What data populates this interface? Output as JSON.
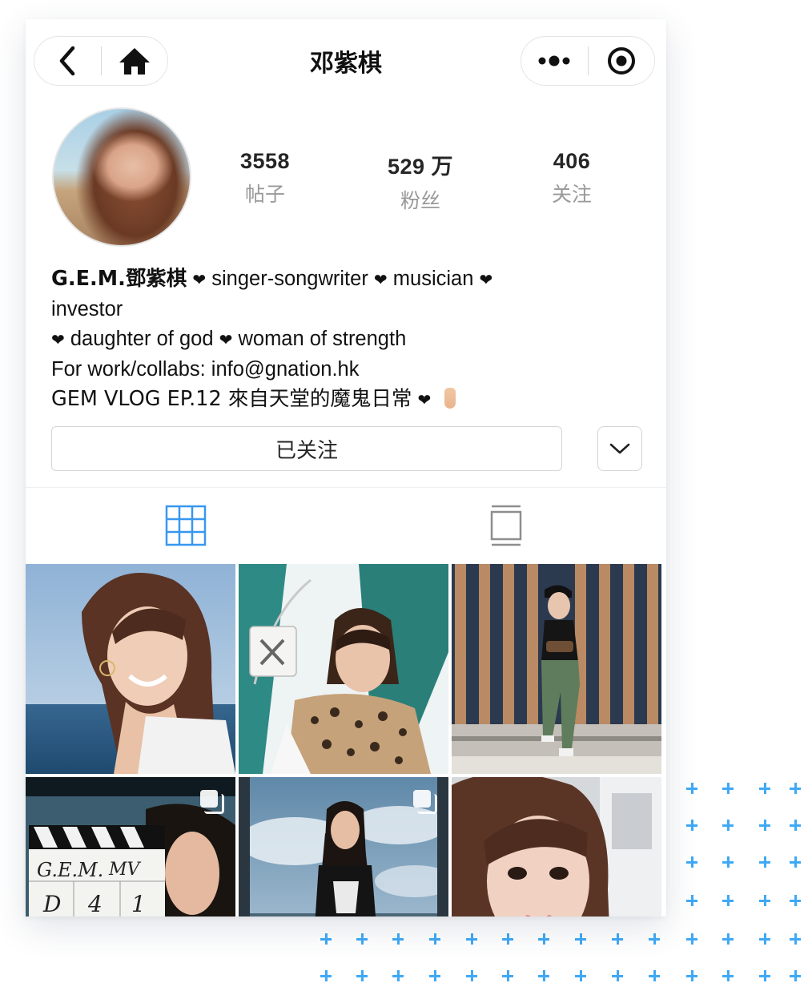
{
  "nav": {
    "title": "邓紫棋",
    "icons": [
      "back-arrow-icon",
      "home-icon",
      "more-dots-icon",
      "record-circle-icon"
    ]
  },
  "profile": {
    "stats": [
      {
        "value": "3558",
        "label": "帖子"
      },
      {
        "value": "529 万",
        "label": "粉丝"
      },
      {
        "value": "406",
        "label": "关注"
      }
    ],
    "bio": {
      "name": "G.E.M.鄧紫棋",
      "line1_rest": "singer-songwriter",
      "line1_rest2": "musician",
      "line2": "investor",
      "line3a": "daughter of god",
      "line3b": "woman of strength",
      "line4": "For work/collabs: info@gnation.hk",
      "line5": "GEM VLOG EP.12 來自天堂的魔鬼日常",
      "heart": "❤"
    },
    "follow_button": "已关注",
    "dropdown_icon": "chevron-down-icon"
  },
  "tabs": [
    {
      "icon": "grid-icon",
      "active": true
    },
    {
      "icon": "feed-view-icon",
      "active": false
    }
  ],
  "colors": {
    "accent": "#3897f0",
    "muted_text": "#999999",
    "border": "#d4d4d4",
    "decor_plus": "#3fa9f5"
  },
  "grid": {
    "photos": [
      {
        "description_icon": "photo-smiling-sea"
      },
      {
        "description_icon": "photo-leopard-scarf-handbag"
      },
      {
        "description_icon": "photo-standing-wood-wall"
      },
      {
        "description_icon": "photo-clapperboard",
        "multi": true,
        "clapper_text": [
          "G.E.M.",
          "MV",
          "D",
          "4",
          "1"
        ]
      },
      {
        "description_icon": "photo-sky-braids",
        "multi": true
      },
      {
        "description_icon": "photo-selfie-closeup"
      }
    ]
  }
}
